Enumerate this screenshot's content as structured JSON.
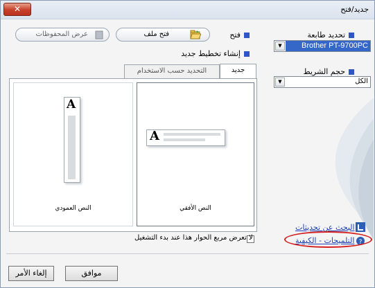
{
  "window": {
    "title": "جديد/فتح"
  },
  "top": {
    "open_label": "فتح",
    "open_file_button": "فتح ملف",
    "view_saved_button": "عرض المحفوظات",
    "create_new_label": "إنشاء تخطيط جديد"
  },
  "printer": {
    "label": "تحديد طابعة",
    "selected": "Brother PT-9700PC"
  },
  "tape": {
    "label": "حجم الشريط",
    "selected": "الكل"
  },
  "tabs": [
    {
      "label": "جديد"
    },
    {
      "label": "التحديد حسب الاستخدام"
    }
  ],
  "layouts": [
    {
      "label": "النص الأفقي",
      "glyph": "A"
    },
    {
      "label": "النص العمودي",
      "glyph": "A"
    }
  ],
  "checkbox": {
    "label": "لا تعرض مربع الحوار هذا عند بدء التشغيل",
    "checked": false
  },
  "links": {
    "updates": "البحث عن تحديثات",
    "help": "التلميحات - الكيفية"
  },
  "buttons": {
    "ok": "موافق",
    "cancel": "إلغاء الأمر"
  }
}
